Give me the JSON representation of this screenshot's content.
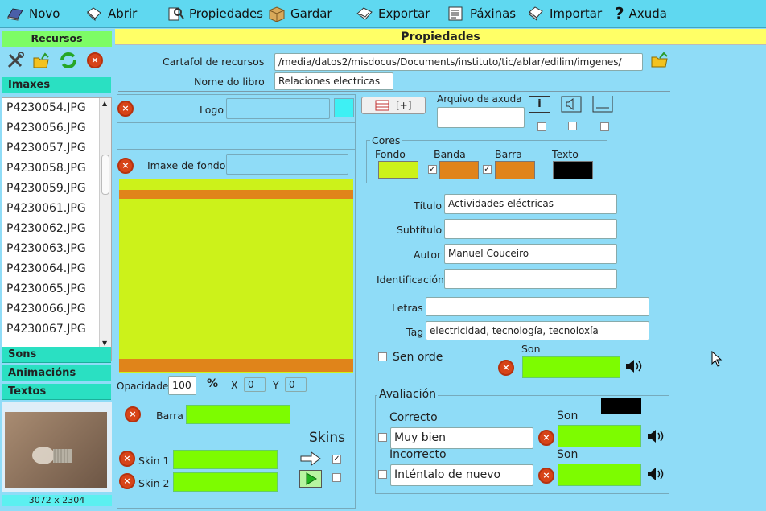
{
  "toolbar": {
    "new": "Novo",
    "open": "Abrir",
    "properties": "Propiedades",
    "save": "Gardar",
    "export": "Exportar",
    "pages": "Páxinas",
    "import": "Importar",
    "help": "Axuda"
  },
  "left": {
    "resources_title": "Recursos",
    "images_title": "Imaxes",
    "images": [
      "P4230054.JPG",
      "P4230056.JPG",
      "P4230057.JPG",
      "P4230058.JPG",
      "P4230059.JPG",
      "P4230061.JPG",
      "P4230062.JPG",
      "P4230063.JPG",
      "P4230064.JPG",
      "P4230065.JPG",
      "P4230066.JPG",
      "P4230067.JPG"
    ],
    "sounds_title": "Sons",
    "animations_title": "Animacións",
    "texts_title": "Textos",
    "thumb_size": "3072 x 2304"
  },
  "props": {
    "title": "Propiedades",
    "folder_label": "Cartafol de recursos",
    "folder_value": "/media/datos2/misdocus/Documents/instituto/tic/ablar/edilim/imgenes/",
    "book_label": "Nome do libro",
    "book_value": "Relaciones electricas",
    "logo_label": "Logo",
    "bg_label": "Imaxe de fondo",
    "opacity_label": "Opacidade",
    "opacity_value": "100",
    "percent": "%",
    "x_label": "X",
    "x_value": "0",
    "y_label": "Y",
    "y_value": "0",
    "bar_label": "Barra",
    "skins_title": "Skins",
    "skin1_label": "Skin 1",
    "skin2_label": "Skin 2",
    "help_btn": "[+]",
    "help_file_label": "Arquivo de axuda",
    "colors_title": "Cores",
    "bg_color_label": "Fondo",
    "band_label": "Banda",
    "bar_color_label": "Barra",
    "text_color_label": "Texto",
    "colors": {
      "fondo": "#ccf21a",
      "banda": "#e0841a",
      "barra": "#e0841a",
      "texto": "#000000"
    },
    "title_label": "Título",
    "title_value": "Actividades eléctricas",
    "subtitle_label": "Subtítulo",
    "subtitle_value": "",
    "author_label": "Autor",
    "author_value": "Manuel Couceiro",
    "id_label": "Identificación",
    "id_value": "",
    "letters_label": "Letras",
    "letters_value": "",
    "tag_label": "Tag",
    "tag_value": "electricidad, tecnología, tecnoloxía",
    "no_order_label": "Sen orde",
    "sound_label": "Son",
    "eval_title": "Avaliación",
    "correct_label": "Correcto",
    "correct_value": "Muy bien",
    "incorrect_label": "Incorrecto",
    "incorrect_value": "Inténtalo de nuevo"
  }
}
